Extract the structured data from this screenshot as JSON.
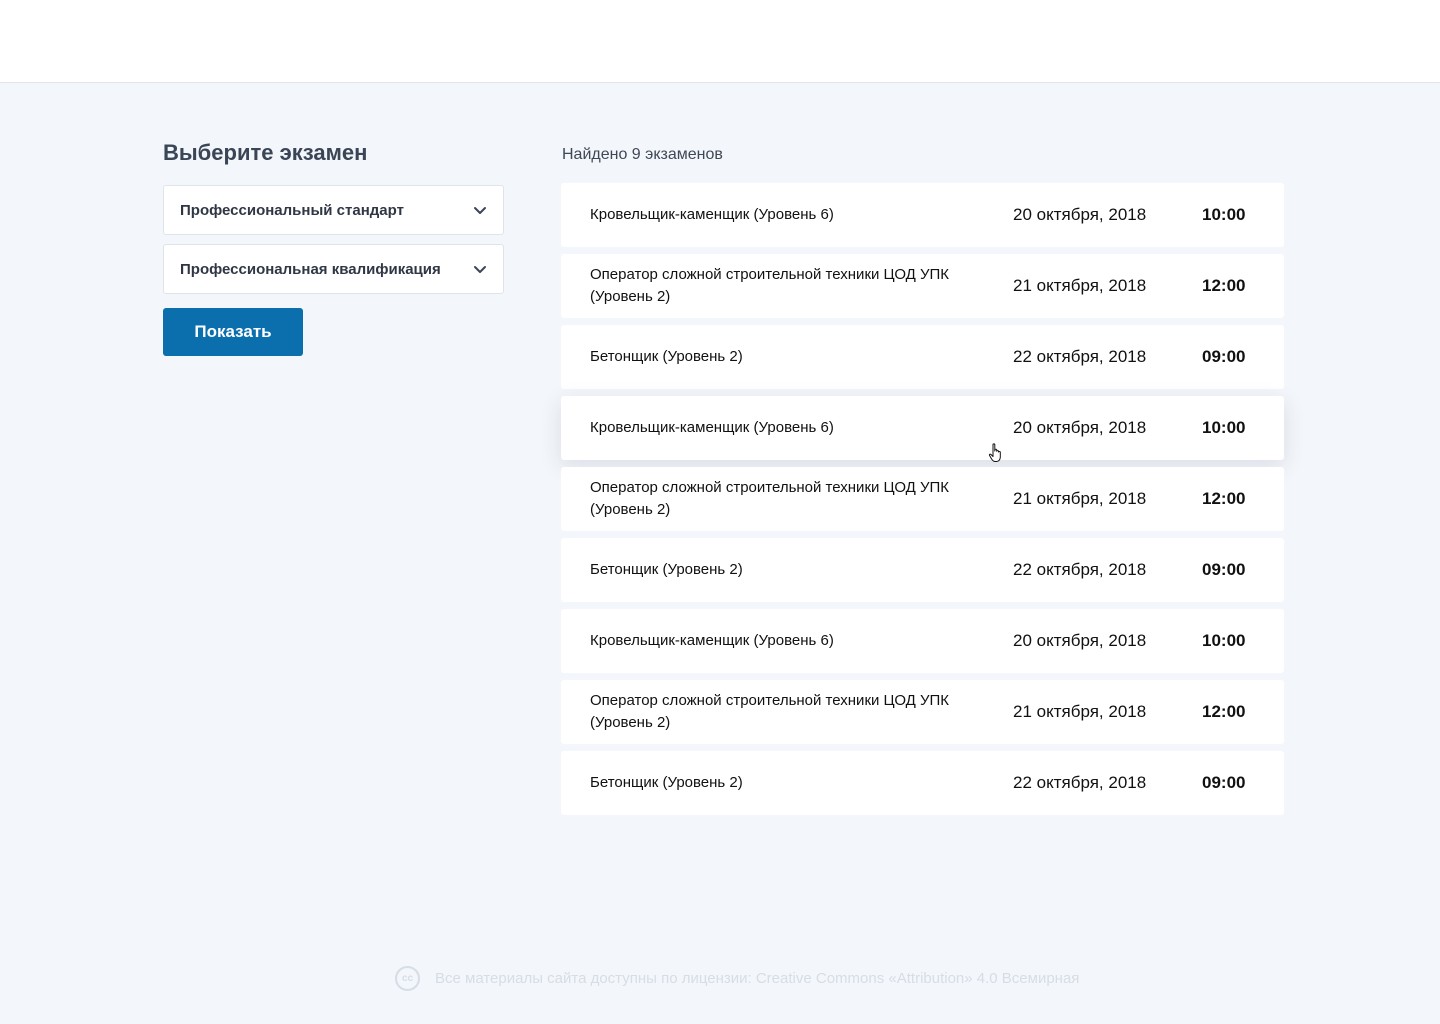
{
  "filters": {
    "title": "Выберите экзамен",
    "standard_label": "Профессиональный стандарт",
    "qualification_label": "Профессиональная квалификация",
    "show_button": "Показать"
  },
  "results": {
    "count_text": "Найдено 9 экзаменов",
    "rows": [
      {
        "name": "Кровельщик-каменщик (Уровень 6)",
        "date": "20 октября, 2018",
        "time": "10:00"
      },
      {
        "name": "Оператор сложной строительной техники ЦОД УПК (Уровень 2)",
        "date": "21 октября, 2018",
        "time": "12:00"
      },
      {
        "name": "Бетонщик (Уровень 2)",
        "date": "22 октября, 2018",
        "time": "09:00"
      },
      {
        "name": "Кровельщик-каменщик (Уровень 6)",
        "date": "20 октября, 2018",
        "time": "10:00"
      },
      {
        "name": "Оператор сложной строительной техники ЦОД УПК (Уровень 2)",
        "date": "21 октября, 2018",
        "time": "12:00"
      },
      {
        "name": "Бетонщик (Уровень 2)",
        "date": "22 октября, 2018",
        "time": "09:00"
      },
      {
        "name": "Кровельщик-каменщик (Уровень 6)",
        "date": "20 октября, 2018",
        "time": "10:00"
      },
      {
        "name": "Оператор сложной строительной техники ЦОД УПК (Уровень 2)",
        "date": "21 октября, 2018",
        "time": "12:00"
      },
      {
        "name": "Бетонщик (Уровень 2)",
        "date": "22 октября, 2018",
        "time": "09:00"
      }
    ]
  },
  "footer": {
    "icon": "creative-commons-icon",
    "text": "Все материалы сайта доступны по лицензии: Creative Commons «Attribution» 4.0 Всемирная"
  },
  "colors": {
    "accent": "#0b6fae",
    "background": "#f3f6fa"
  }
}
